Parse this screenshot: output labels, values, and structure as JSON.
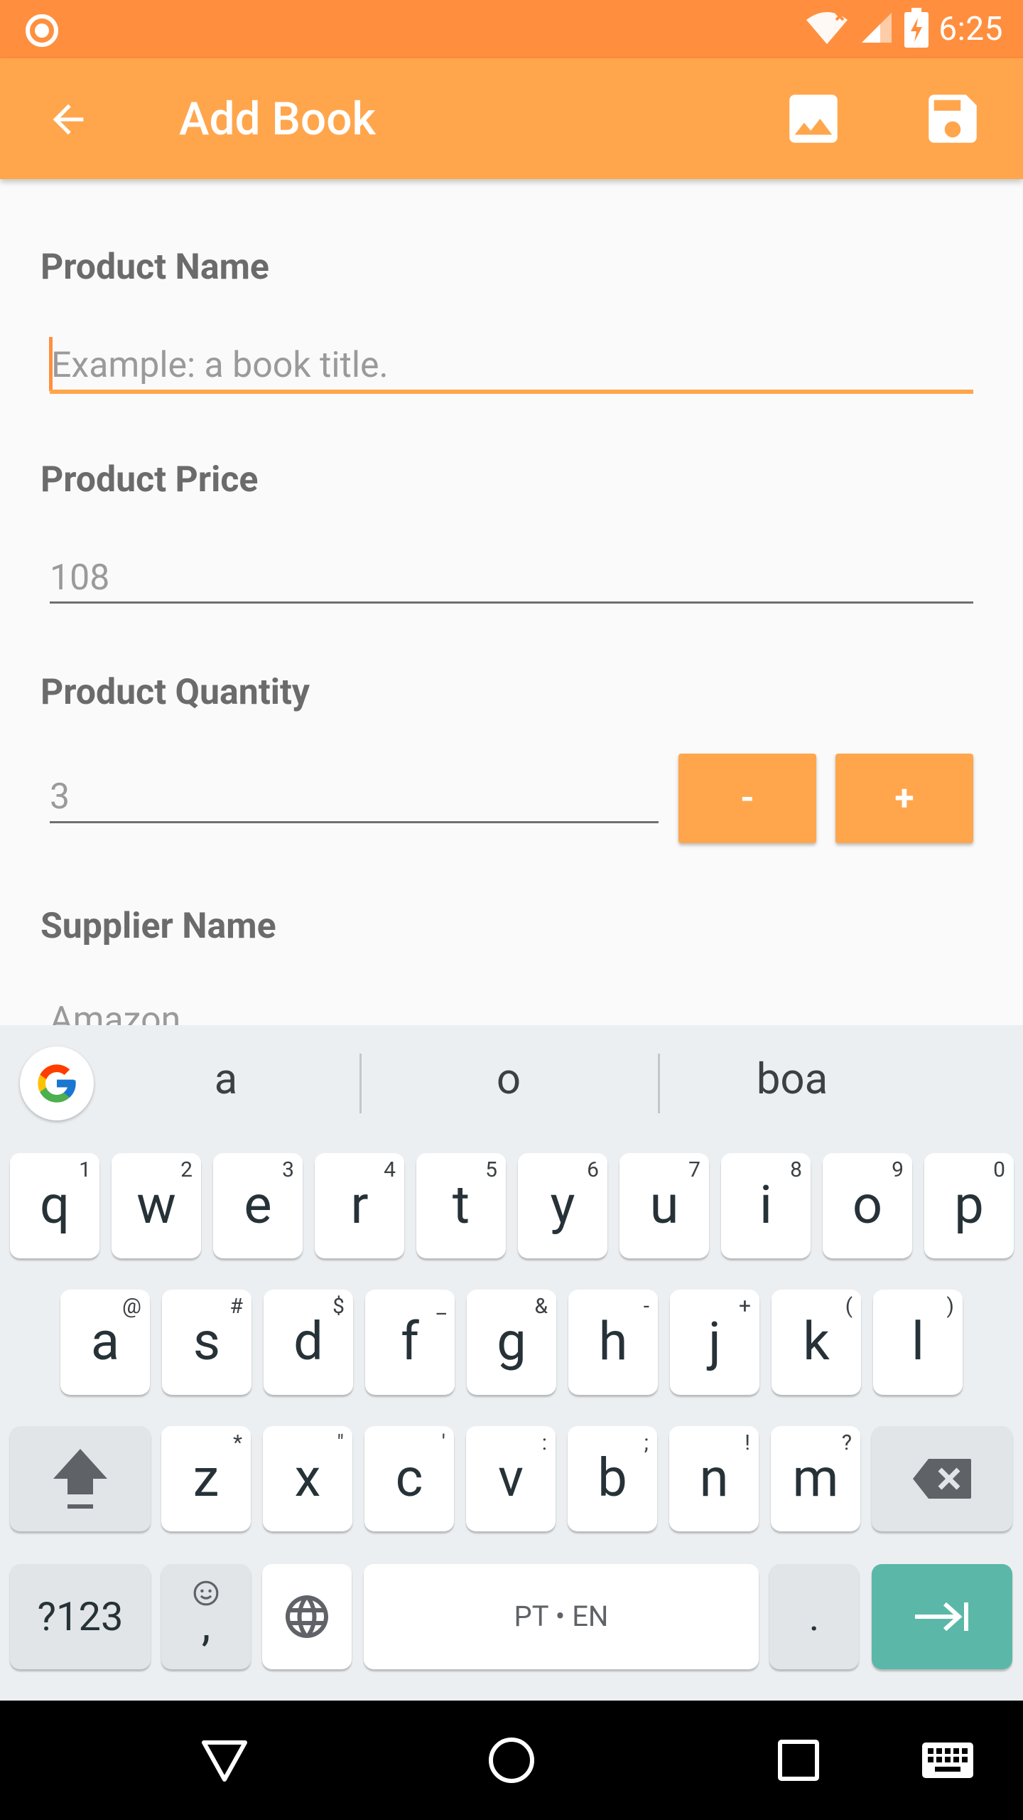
{
  "status_bar": {
    "time": "6:25",
    "icons": [
      "notification-circle-icon",
      "wifi-icon",
      "cell-signal-icon",
      "battery-charging-icon"
    ]
  },
  "app_bar": {
    "title": "Add Book",
    "back_icon": "arrow-back-icon",
    "actions": [
      "image-icon",
      "save-icon"
    ],
    "color": "#ffa64d"
  },
  "form": {
    "product_name": {
      "label": "Product Name",
      "placeholder": "Example: a book title.",
      "value": ""
    },
    "product_price": {
      "label": "Product Price",
      "value": "108"
    },
    "product_quantity": {
      "label": "Product Quantity",
      "value": "3",
      "decrement_label": "-",
      "increment_label": "+"
    },
    "supplier_name": {
      "label": "Supplier Name",
      "value": "Amazon"
    }
  },
  "keyboard": {
    "suggestions": [
      "a",
      "o",
      "boa"
    ],
    "row1": [
      {
        "key": "q",
        "hint": "1"
      },
      {
        "key": "w",
        "hint": "2"
      },
      {
        "key": "e",
        "hint": "3"
      },
      {
        "key": "r",
        "hint": "4"
      },
      {
        "key": "t",
        "hint": "5"
      },
      {
        "key": "y",
        "hint": "6"
      },
      {
        "key": "u",
        "hint": "7"
      },
      {
        "key": "i",
        "hint": "8"
      },
      {
        "key": "o",
        "hint": "9"
      },
      {
        "key": "p",
        "hint": "0"
      }
    ],
    "row2": [
      {
        "key": "a",
        "hint": "@"
      },
      {
        "key": "s",
        "hint": "#"
      },
      {
        "key": "d",
        "hint": "$"
      },
      {
        "key": "f",
        "hint": "_"
      },
      {
        "key": "g",
        "hint": "&"
      },
      {
        "key": "h",
        "hint": "-"
      },
      {
        "key": "j",
        "hint": "+"
      },
      {
        "key": "k",
        "hint": "("
      },
      {
        "key": "l",
        "hint": ")"
      }
    ],
    "row3": [
      {
        "key": "z",
        "hint": "*"
      },
      {
        "key": "x",
        "hint": "\""
      },
      {
        "key": "c",
        "hint": "'"
      },
      {
        "key": "v",
        "hint": ":"
      },
      {
        "key": "b",
        "hint": ";"
      },
      {
        "key": "n",
        "hint": "!"
      },
      {
        "key": "m",
        "hint": "?"
      }
    ],
    "symbols_label": "?123",
    "emoji_comma_label": ",",
    "space_label": "PT • EN",
    "period_label": ".",
    "enter_color": "#5bb8a8"
  },
  "nav_bar": {
    "icons": [
      "back-triangle-icon",
      "home-circle-icon",
      "recents-square-icon",
      "keyboard-icon"
    ]
  }
}
